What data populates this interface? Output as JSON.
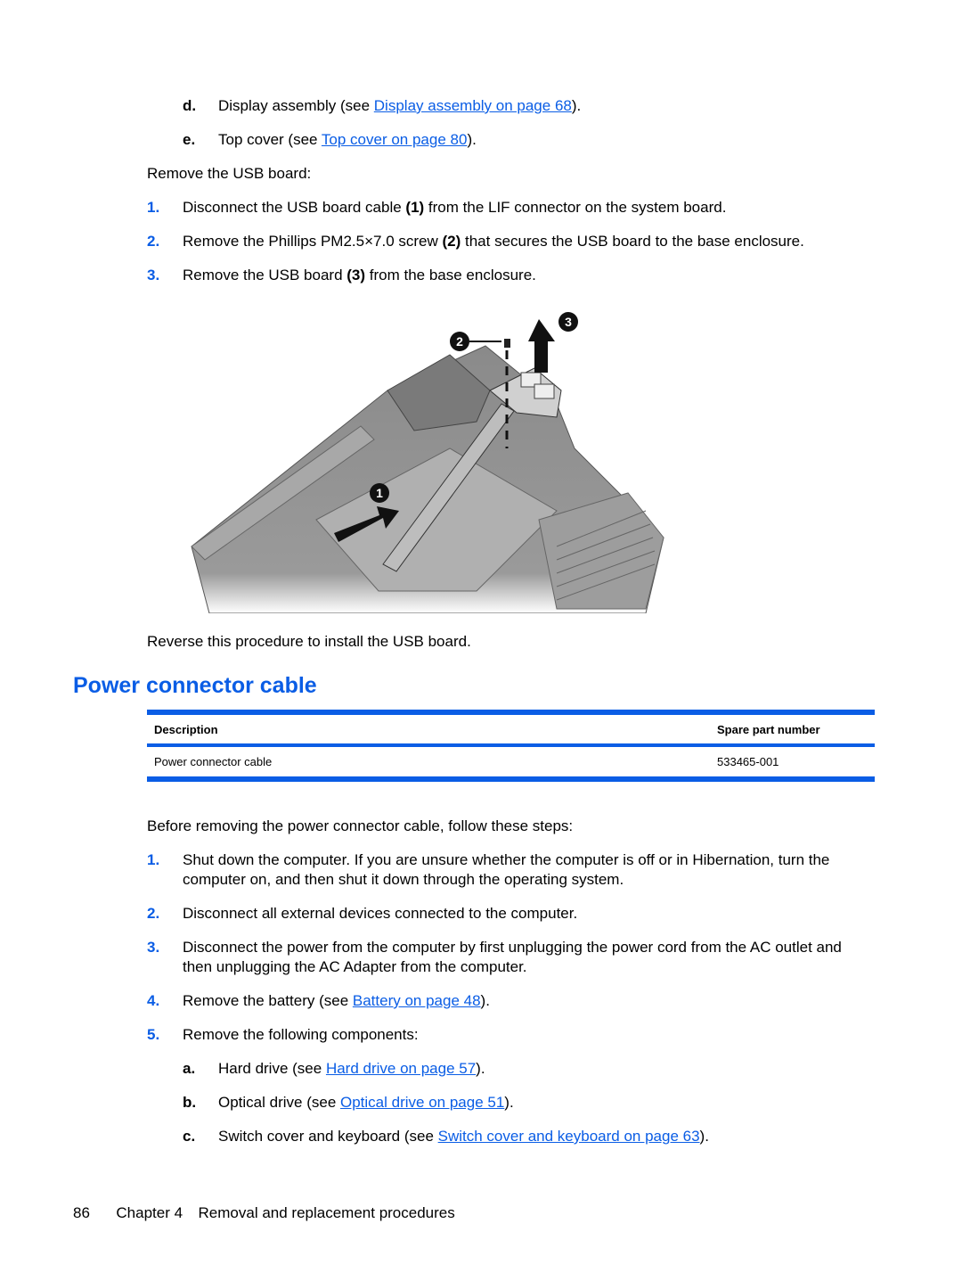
{
  "prev_substeps": [
    {
      "letter": "d.",
      "pre": "Display assembly (see ",
      "link": "Display assembly on page 68",
      "post": ")."
    },
    {
      "letter": "e.",
      "pre": "Top cover (see ",
      "link": "Top cover on page 80",
      "post": ")."
    }
  ],
  "usb_intro": "Remove the USB board:",
  "usb_steps": [
    {
      "num": "1.",
      "pre": "Disconnect the USB board cable ",
      "callout": "(1)",
      "post": " from the LIF connector on the system board."
    },
    {
      "num": "2.",
      "pre": "Remove the Phillips PM2.5×7.0 screw ",
      "callout": "(2)",
      "post": " that secures the USB board to the base enclosure."
    },
    {
      "num": "3.",
      "pre": "Remove the USB board ",
      "callout": "(3)",
      "post": " from the base enclosure."
    }
  ],
  "figure": {
    "description": "USB board removal illustration",
    "callouts": [
      "1",
      "2",
      "3"
    ]
  },
  "usb_outro": "Reverse this procedure to install the USB board.",
  "section_title": "Power connector cable",
  "table": {
    "headers": [
      "Description",
      "Spare part number"
    ],
    "rows": [
      [
        "Power connector cable",
        "533465-001"
      ]
    ]
  },
  "power_intro": "Before removing the power connector cable, follow these steps:",
  "power_steps": [
    {
      "num": "1.",
      "lines": [
        "Shut down the computer. If you are unsure whether the computer is off or in Hibernation, turn the",
        "computer on, and then shut it down through the operating system."
      ]
    },
    {
      "num": "2.",
      "lines": [
        "Disconnect all external devices connected to the computer."
      ]
    },
    {
      "num": "3.",
      "lines": [
        "Disconnect the power from the computer by first unplugging the power cord from the AC outlet and",
        "then unplugging the AC Adapter from the computer."
      ]
    },
    {
      "num": "4.",
      "pre": "Remove the battery (see ",
      "link": "Battery on page 48",
      "post": ")."
    },
    {
      "num": "5.",
      "lines": [
        "Remove the following components:"
      ]
    }
  ],
  "components": [
    {
      "letter": "a.",
      "pre": "Hard drive (see ",
      "link": "Hard drive on page 57",
      "post": ")."
    },
    {
      "letter": "b.",
      "pre": "Optical drive (see ",
      "link": "Optical drive on page 51",
      "post": ")."
    },
    {
      "letter": "c.",
      "pre": "Switch cover and keyboard (see ",
      "link": "Switch cover and keyboard on page 63",
      "post": ")."
    }
  ],
  "footer": {
    "page_number": "86",
    "chapter": "Chapter 4",
    "chapter_title": "Removal and replacement procedures"
  },
  "colors": {
    "accent": "#0a5de5",
    "text": "#000000"
  }
}
